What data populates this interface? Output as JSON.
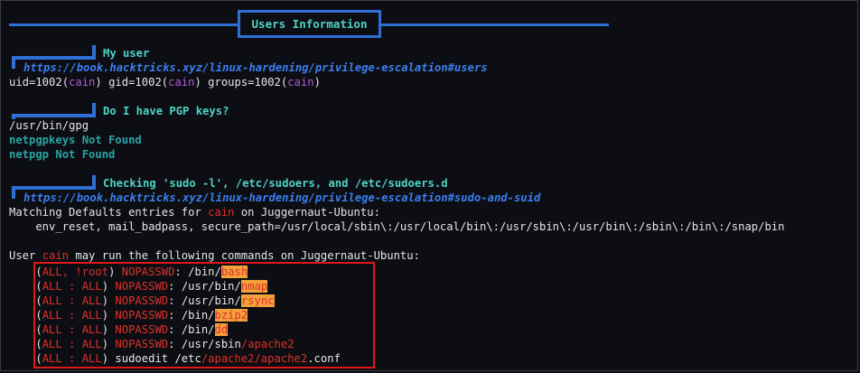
{
  "header": {
    "title": "Users Information"
  },
  "sections": {
    "my_user": {
      "heading": "My user",
      "link": "https://book.hacktricks.xyz/linux-hardening/privilege-escalation#users",
      "id_line": {
        "p1": "uid=1002(",
        "u1": "cain",
        "p2": ") gid=1002(",
        "u2": "cain",
        "p3": ") groups=1002(",
        "u3": "cain",
        "p4": ")"
      }
    },
    "pgp": {
      "heading": "Do I have PGP keys?",
      "gpg_path": "/usr/bin/gpg",
      "netpgpkeys": "netpgpkeys Not Found",
      "netpgp": "netpgp Not Found"
    },
    "sudo": {
      "heading": "Checking 'sudo -l', /etc/sudoers, and /etc/sudoers.d",
      "link": "https://book.hacktricks.xyz/linux-hardening/privilege-escalation#sudo-and-suid",
      "matching": {
        "pre": "Matching Defaults entries for ",
        "user": "cain",
        "post": " on Juggernaut-Ubuntu:"
      },
      "env": "    env_reset, mail_badpass, secure_path=/usr/local/sbin\\:/usr/local/bin\\:/usr/sbin\\:/usr/bin\\:/sbin\\:/bin\\:/snap/bin",
      "may_run": {
        "pre": "User ",
        "user": "cain",
        "post": " may run the following commands on Juggernaut-Ubuntu:"
      },
      "rules": [
        {
          "open": "    (",
          "runas": "ALL, !root",
          "close": ") ",
          "tag": "NOPASSWD",
          "colon": ": ",
          "path": "/bin/",
          "bin": "bash",
          "rest": ""
        },
        {
          "open": "    (",
          "runas": "ALL : ALL",
          "close": ") ",
          "tag": "NOPASSWD",
          "colon": ": ",
          "path": "/usr/bin/",
          "bin": "nmap",
          "rest": ""
        },
        {
          "open": "    (",
          "runas": "ALL : ALL",
          "close": ") ",
          "tag": "NOPASSWD",
          "colon": ": ",
          "path": "/usr/bin/",
          "bin": "rsync",
          "rest": ""
        },
        {
          "open": "    (",
          "runas": "ALL : ALL",
          "close": ") ",
          "tag": "NOPASSWD",
          "colon": ": ",
          "path": "/bin/",
          "bin": "bzip2",
          "rest": ""
        },
        {
          "open": "    (",
          "runas": "ALL : ALL",
          "close": ") ",
          "tag": "NOPASSWD",
          "colon": ": ",
          "path": "/bin/",
          "bin": "dd",
          "rest": ""
        },
        {
          "open": "    (",
          "runas": "ALL : ALL",
          "close": ") ",
          "tag": "NOPASSWD",
          "colon": ": ",
          "path": "/usr/sbin",
          "bin": "/apache2",
          "rest": ""
        }
      ],
      "sudoedit": {
        "open": "    (",
        "runas": "ALL : ALL",
        "close": ") ",
        "cmd": "sudoedit /etc",
        "red": "/apache2/apache2",
        "ext": ".conf"
      }
    }
  },
  "colors": {
    "accent": "#2f6fd6",
    "heading": "#4fd3c4",
    "link": "#3b7ff0",
    "user": "#b25ad7",
    "danger": "#e0302a",
    "highlight": "#f2a13b"
  }
}
